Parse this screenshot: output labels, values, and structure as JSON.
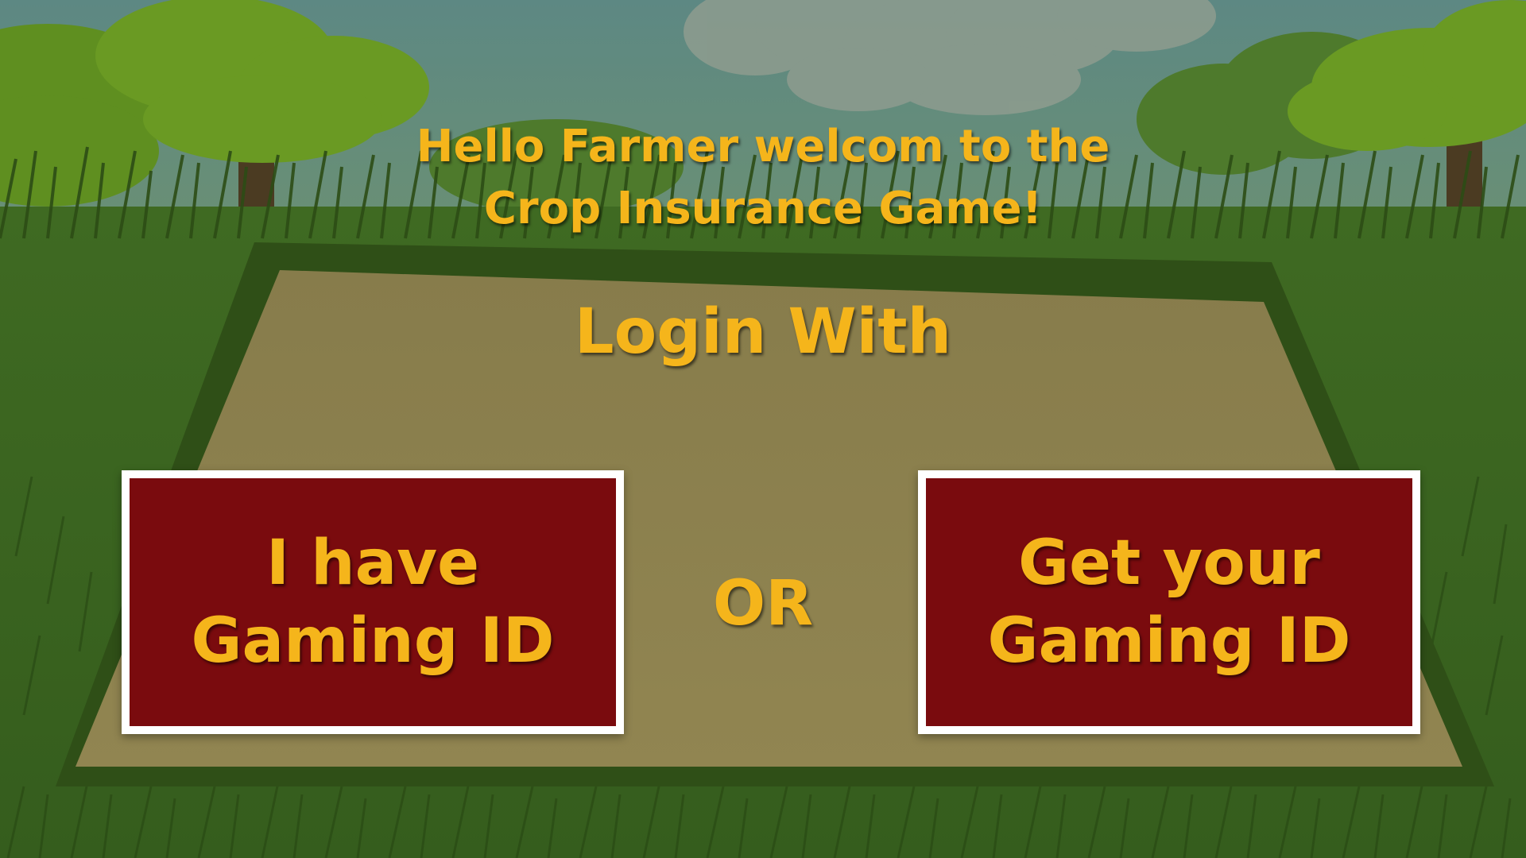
{
  "welcome": {
    "line1": "Hello Farmer welcom to the",
    "line2": "Crop Insurance Game!"
  },
  "login": {
    "heading": "Login With",
    "or_label": "OR",
    "have_id_button": {
      "line1": "I have",
      "line2": "Gaming ID"
    },
    "get_id_button": {
      "line1": "Get your",
      "line2": "Gaming ID"
    }
  },
  "colors": {
    "title_text": "#f5b51b",
    "button_fill": "#7a0b0e",
    "button_border": "#ffffff",
    "field": "#8a7e4a",
    "field_border": "#2f4f17",
    "grass": "#3d6b22",
    "sky": "#5e8a86",
    "tree": "#6a9a23"
  }
}
